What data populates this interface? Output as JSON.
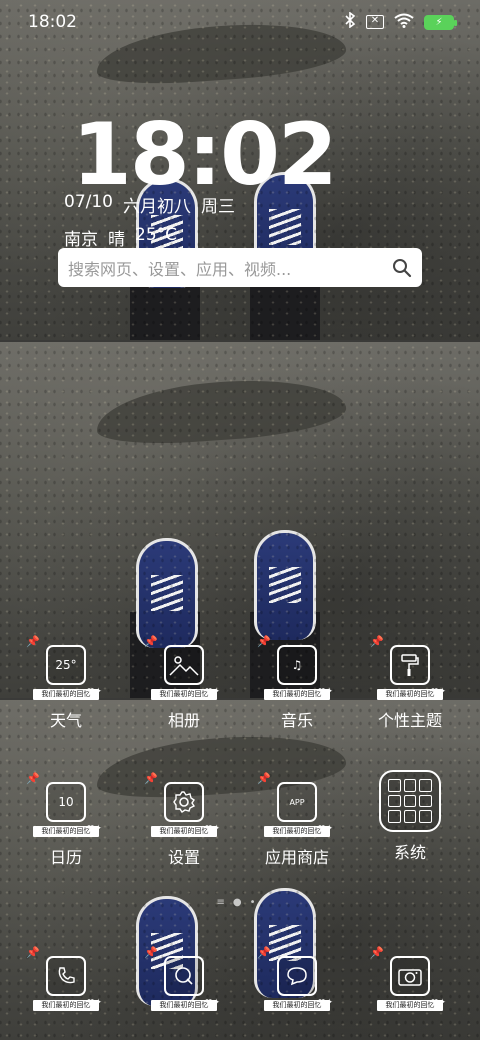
{
  "status_bar": {
    "time": "18:02",
    "icons": [
      "bluetooth-icon",
      "sim-blocked-icon",
      "wifi-icon",
      "battery-charging-icon"
    ]
  },
  "clock_widget": {
    "time": "18:02",
    "date": "07/10",
    "lunar_date": "六月初八",
    "weekday": "周三",
    "city": "南京",
    "condition": "晴",
    "temperature": "25°C"
  },
  "search": {
    "placeholder": "搜索网页、设置、应用、视频..."
  },
  "ribbon_text": "我们最初的回忆",
  "apps": {
    "weather": {
      "label": "天气",
      "tile_text": "25°"
    },
    "gallery": {
      "label": "相册"
    },
    "music": {
      "label": "音乐"
    },
    "themes": {
      "label": "个性主题"
    },
    "calendar": {
      "label": "日历",
      "tile_text": "10"
    },
    "settings": {
      "label": "设置"
    },
    "app_store": {
      "label": "应用商店",
      "tile_text": "APP"
    },
    "system": {
      "label": "系统"
    }
  },
  "dock": [
    "phone-icon",
    "browser-icon",
    "messages-icon",
    "camera-icon"
  ],
  "page_indicator": {
    "pages": 3,
    "active": 2
  }
}
